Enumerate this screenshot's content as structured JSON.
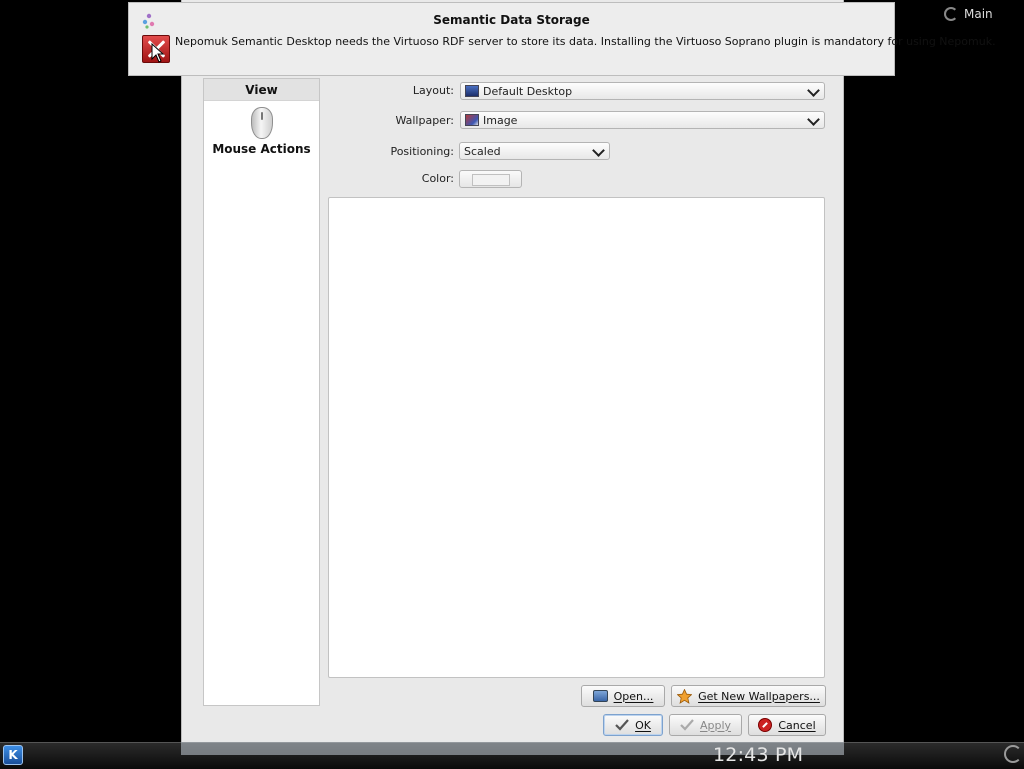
{
  "desktop": {
    "activity_label": "Main"
  },
  "dialog": {
    "pages": [
      {
        "label": "View",
        "selected": true
      },
      {
        "label": "Mouse Actions",
        "icon": "mouse-icon",
        "selected": false
      }
    ],
    "layout": {
      "label": "Layout:",
      "value": "Default Desktop",
      "icon": "desktop-layout-icon"
    },
    "wallpaper": {
      "label": "Wallpaper:",
      "value": "Image",
      "icon": "image-wallpaper-icon"
    },
    "positioning": {
      "label": "Positioning:",
      "value": "Scaled"
    },
    "color": {
      "label": "Color:",
      "swatch": "#f2f2f2"
    },
    "buttons": {
      "open": "Open...",
      "get_new": "Get New Wallpapers...",
      "ok": "OK",
      "apply": "Apply",
      "cancel": "Cancel"
    }
  },
  "notification": {
    "title": "Semantic Data Storage",
    "message": "Nepomuk Semantic Desktop needs the Virtuoso RDF server to store its data. Installing the Virtuoso Soprano plugin is mandatory for using Nepomuk.",
    "icon": "error-icon"
  },
  "taskbar": {
    "clock": "12:43 PM",
    "launcher_glyph": "K"
  }
}
